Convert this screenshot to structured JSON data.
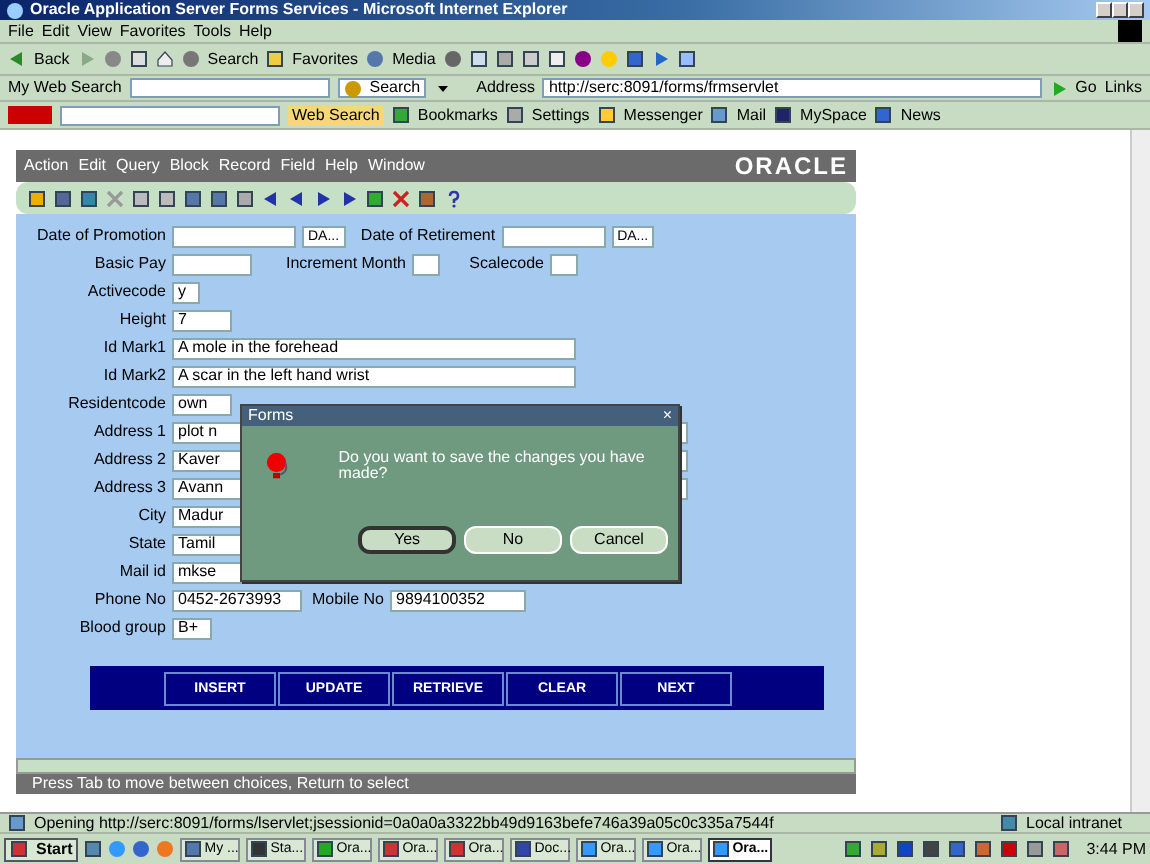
{
  "window": {
    "title": "Oracle Application Server Forms Services - Microsoft Internet Explorer"
  },
  "menu": [
    "File",
    "Edit",
    "View",
    "Favorites",
    "Tools",
    "Help"
  ],
  "toolbar": {
    "back": "Back",
    "search": "Search",
    "favorites": "Favorites",
    "media": "Media"
  },
  "search_bar": {
    "label": "My Web Search",
    "button": "Search"
  },
  "address": {
    "label": "Address",
    "url": "http://serc:8091/forms/frmservlet",
    "go": "Go",
    "links": "Links"
  },
  "yahoo_bar": {
    "button": "Web Search",
    "items": [
      "Bookmarks",
      "Settings",
      "Messenger",
      "Mail",
      "MySpace",
      "News"
    ]
  },
  "applet": {
    "menu": [
      "Action",
      "Edit",
      "Query",
      "Block",
      "Record",
      "Field",
      "Help",
      "Window"
    ],
    "logo": "ORACLE",
    "form_rows": [
      [
        {
          "label": "Date of Promotion",
          "button": "DA..."
        },
        {
          "label": "Date of Retirement",
          "button": "DA..."
        }
      ],
      [
        {
          "label": "Basic Pay"
        },
        {
          "label": "Increment Month"
        },
        {
          "label": "Scalecode"
        }
      ],
      [
        {
          "label": "Activecode",
          "value": "y"
        }
      ],
      [
        {
          "label": "Height",
          "value": "7"
        }
      ],
      [
        {
          "label": "Id Mark1",
          "value": "A mole in the forehead"
        }
      ],
      [
        {
          "label": "Id Mark2",
          "value": "A scar in the left hand wrist"
        }
      ],
      [
        {
          "label": "Residentcode",
          "value": "own"
        }
      ],
      [
        {
          "label": "Address 1",
          "value": "plot n"
        }
      ],
      [
        {
          "label": "Address 2",
          "value": "Kaver"
        }
      ],
      [
        {
          "label": "Address 3",
          "value": "Avann"
        }
      ],
      [
        {
          "label": "City",
          "value": "Madur"
        }
      ],
      [
        {
          "label": "State",
          "value": "Tamil"
        }
      ],
      [
        {
          "label": "Mail id",
          "value": "mkse"
        }
      ],
      [
        {
          "label": "Phone No",
          "value": "0452-2673993"
        },
        {
          "label": "Mobile No",
          "value": "9894100352"
        }
      ],
      [
        {
          "label": "Blood group",
          "value": "B+"
        }
      ]
    ],
    "buttons": [
      "INSERT",
      "UPDATE",
      "RETRIEVE",
      "CLEAR",
      "NEXT"
    ],
    "hint": "Press Tab to move between choices, Return to select"
  },
  "dialog": {
    "title": "Forms",
    "close": "×",
    "message": "Do you want to save the changes you have made?",
    "buttons": [
      {
        "label": "Yes",
        "selected": true
      },
      {
        "label": "No",
        "selected": false
      },
      {
        "label": "Cancel",
        "selected": false
      }
    ]
  },
  "status_bar": {
    "text": "Opening http://serc:8091/forms/lservlet;jsessionid=0a0a0a3322bb49d9163befe746a39a05c0c335a7544f",
    "zone": "Local intranet"
  },
  "taskbar": {
    "start": "Start",
    "tasks": [
      {
        "label": "My ...",
        "selected": false
      },
      {
        "label": "Sta...",
        "selected": false
      },
      {
        "label": "Ora...",
        "selected": false
      },
      {
        "label": "Ora...",
        "selected": false
      },
      {
        "label": "Ora...",
        "selected": false
      },
      {
        "label": "Doc...",
        "selected": false
      },
      {
        "label": "Ora...",
        "selected": false
      },
      {
        "label": "Ora...",
        "selected": false
      },
      {
        "label": "Ora...",
        "selected": true
      }
    ],
    "clock": "3:44 PM"
  }
}
